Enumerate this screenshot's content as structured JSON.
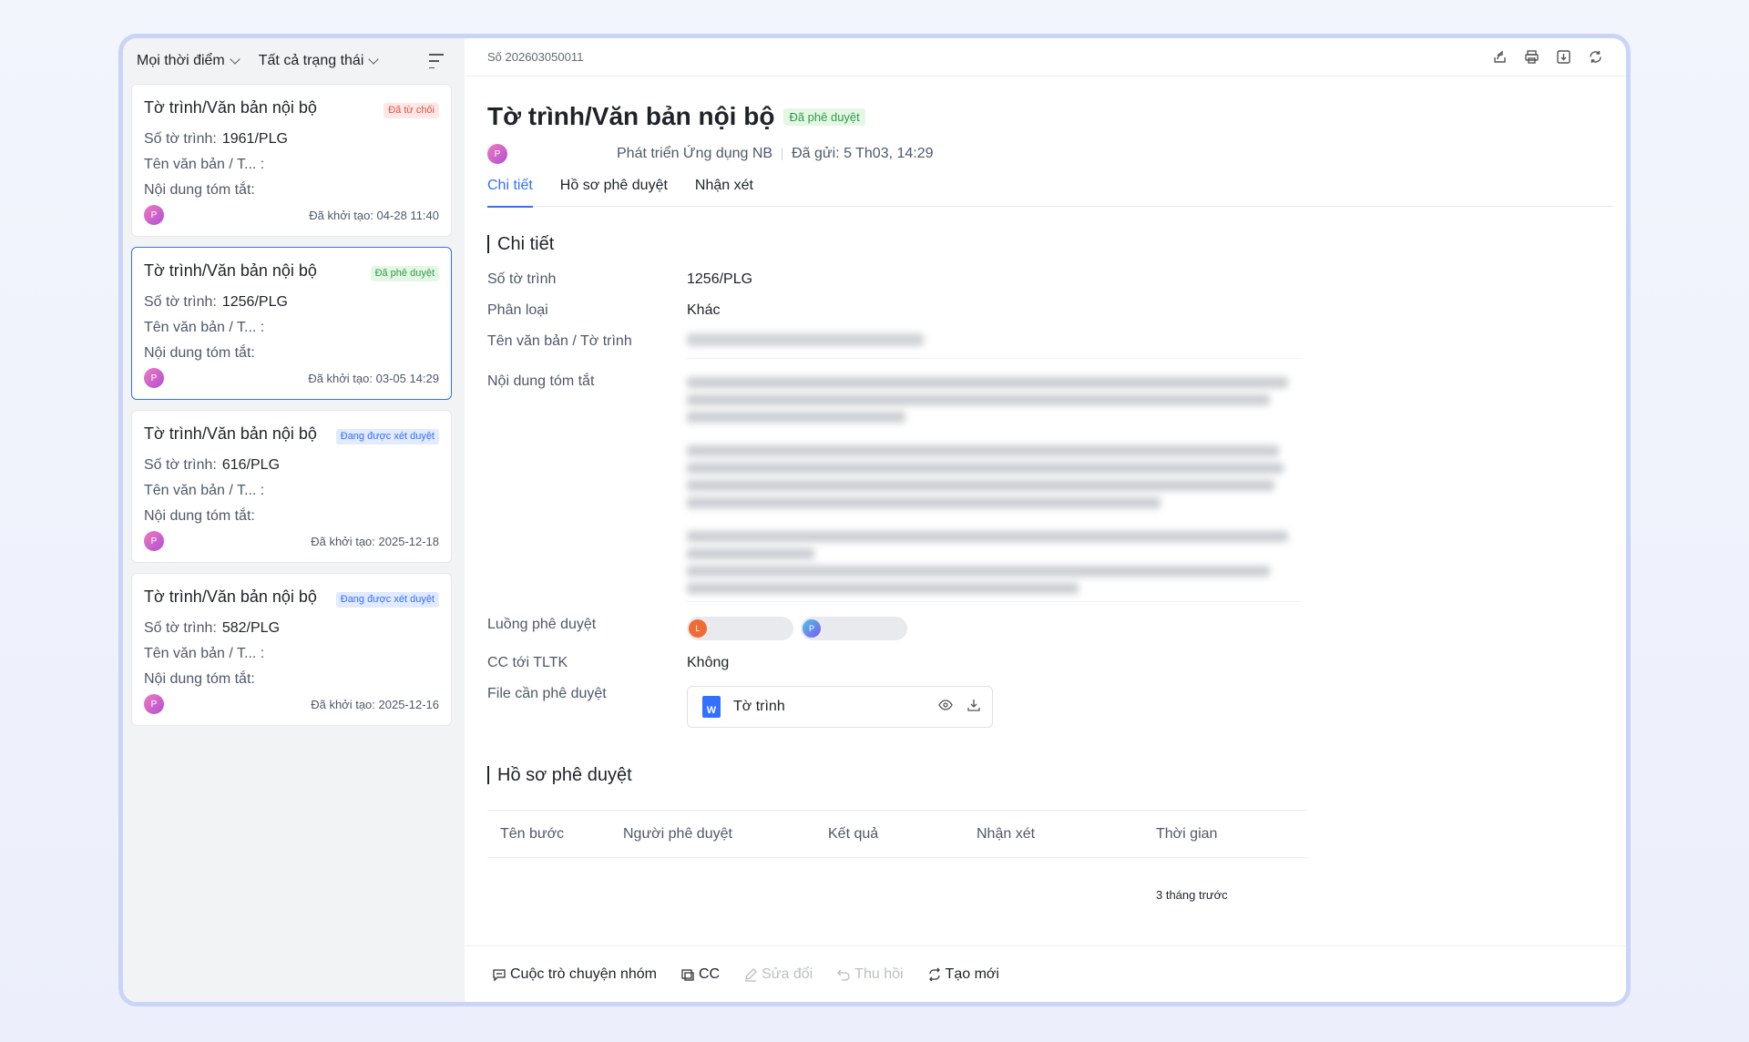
{
  "filters": {
    "time": "Mọi thời điểm",
    "status": "Tất cả trạng thái"
  },
  "list": [
    {
      "title": "Tờ trình/Văn bản nội bộ",
      "badge": "Đã từ chối",
      "number_label": "Số tờ trình:",
      "number": "1961/PLG",
      "name_label": "Tên văn bản / T...",
      "summary_label": "Nội dung tóm tắt:",
      "created": "Đã khởi tạo: 04-28 11:40",
      "avatar": "P"
    },
    {
      "title": "Tờ trình/Văn bản nội bộ",
      "badge": "Đã phê duyệt",
      "number_label": "Số tờ trình:",
      "number": "1256/PLG",
      "name_label": "Tên văn bản / T...",
      "summary_label": "Nội dung tóm tắt:",
      "created": "Đã khởi tạo: 03-05 14:29",
      "avatar": "P"
    },
    {
      "title": "Tờ trình/Văn bản nội bộ",
      "badge": "Đang được xét duyệt",
      "number_label": "Số tờ trình:",
      "number": "616/PLG",
      "name_label": "Tên văn bản / T...",
      "summary_label": "Nội dung tóm tắt:",
      "created": "Đã khởi tạo: 2025-12-18",
      "avatar": "P"
    },
    {
      "title": "Tờ trình/Văn bản nội bộ",
      "badge": "Đang được xét duyệt",
      "number_label": "Số tờ trình:",
      "number": "582/PLG",
      "name_label": "Tên văn bản / T...",
      "summary_label": "Nội dung tóm tắt:",
      "created": "Đã khởi tạo: 2025-12-16",
      "avatar": "P"
    }
  ],
  "detail": {
    "doc_number": "Số 202603050011",
    "title": "Tờ trình/Văn bản nội bộ",
    "status": "Đã phê duyệt",
    "avatar": "P",
    "department": "Phát triển Ứng dụng NB",
    "sent": "Đã gửi: 5 Th03, 14:29",
    "tabs": [
      "Chi tiết",
      "Hồ sơ phê duyệt",
      "Nhận xét"
    ],
    "section_details": "Chi tiết",
    "fields": {
      "number_label": "Số tờ trình",
      "number": "1256/PLG",
      "category_label": "Phân loại",
      "category": "Khác",
      "name_label": "Tên văn bản / Tờ trình",
      "summary_label": "Nội dung tóm tắt",
      "flow_label": "Luồng phê duyệt",
      "flow": [
        {
          "avatar": "L",
          "color": "#f06a35"
        },
        {
          "avatar": "P",
          "color": "#5b6cf0"
        }
      ],
      "cc_label": "CC tới TLTK",
      "cc": "Không",
      "file_label": "File cần phê duyệt",
      "file_name": "Tờ trình",
      "file_icon": "W"
    },
    "section_history": "Hồ sơ phê duyệt",
    "history_columns": [
      "Tên bước",
      "Người phê duyệt",
      "Kết quả",
      "Nhận xét",
      "Thời gian"
    ],
    "history_time": "3 tháng trước"
  },
  "bottom_actions": {
    "group_chat": "Cuộc trò chuyện nhóm",
    "cc": "CC",
    "edit": "Sửa đổi",
    "recall": "Thu hồi",
    "new": "Tạo mới"
  }
}
